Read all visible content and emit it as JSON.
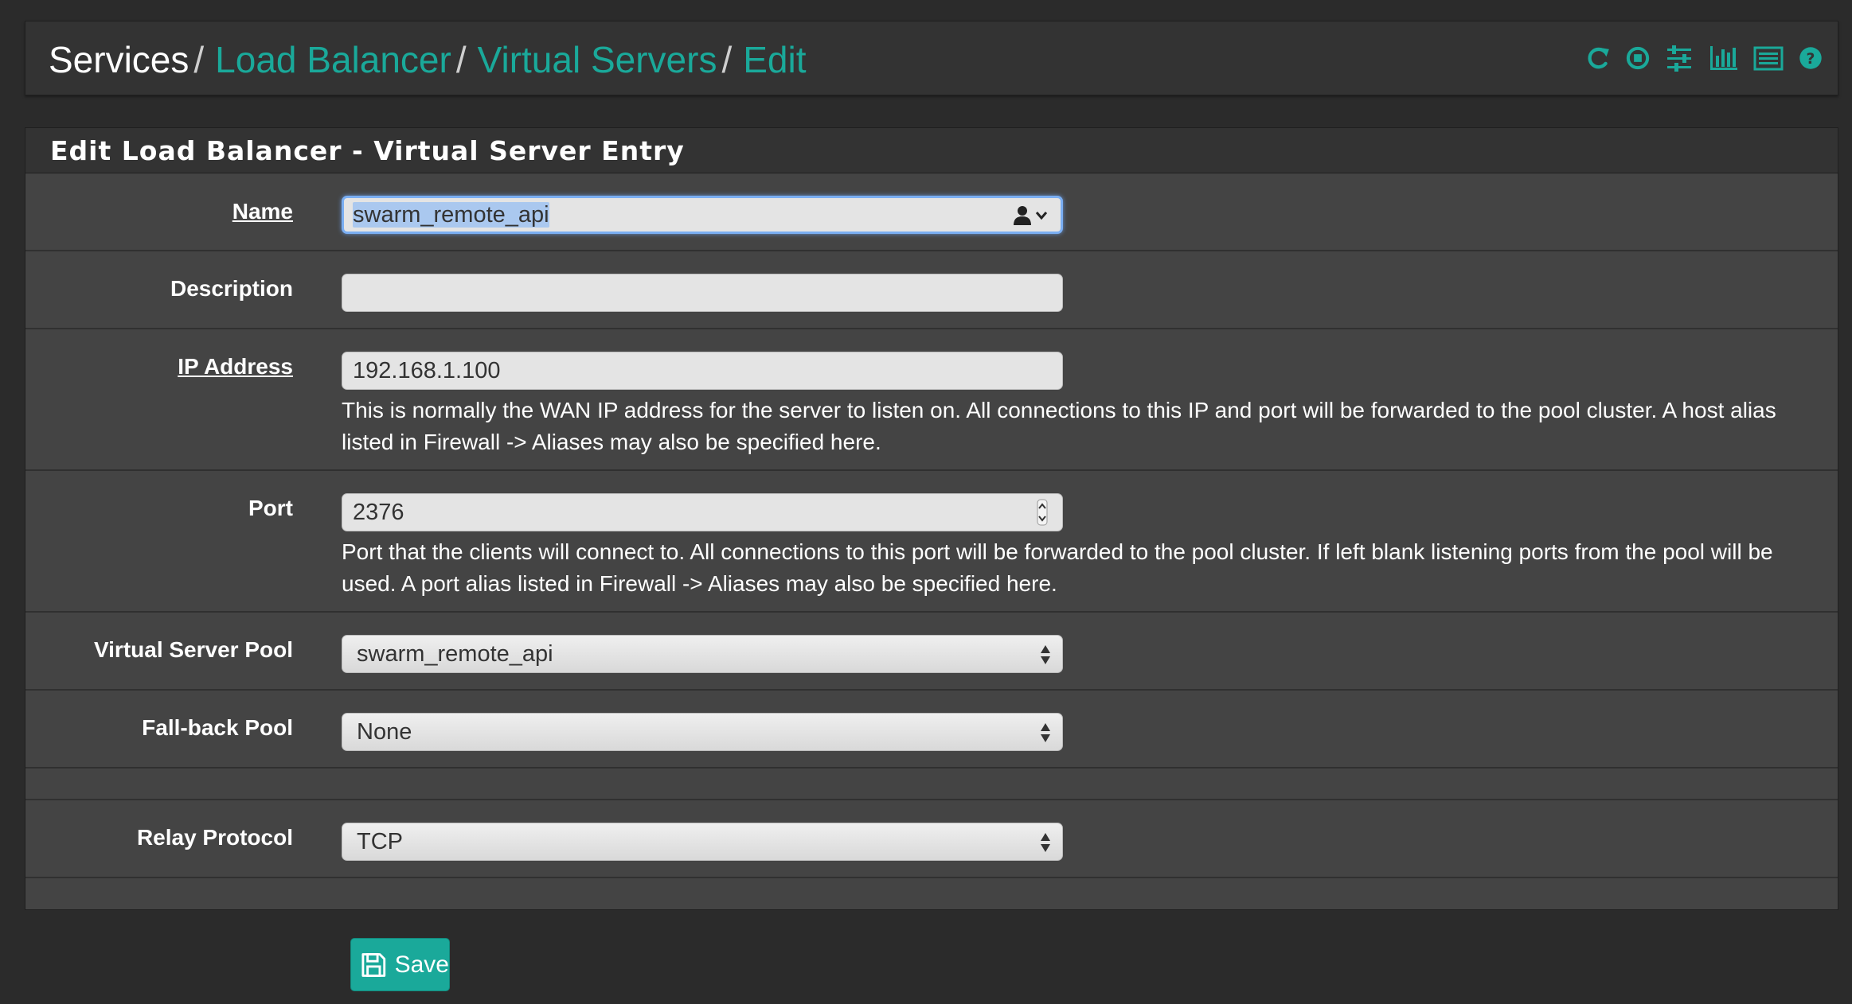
{
  "breadcrumb": {
    "root": "Services",
    "level1": "Load Balancer",
    "level2": "Virtual Servers",
    "current": "Edit",
    "separator": "/"
  },
  "toolbar": {
    "icons": [
      "reload-icon",
      "stop-icon",
      "sliders-icon",
      "bar-chart-icon",
      "log-list-icon",
      "help-icon"
    ]
  },
  "panel": {
    "title": "Edit Load Balancer - Virtual Server Entry"
  },
  "form": {
    "name": {
      "label": "Name",
      "value": "swarm_remote_api"
    },
    "description": {
      "label": "Description",
      "value": ""
    },
    "ip_address": {
      "label": "IP Address",
      "value": "192.168.1.100",
      "help": "This is normally the WAN IP address for the server to listen on. All connections to this IP and port will be forwarded to the pool cluster. A host alias listed in Firewall -> Aliases may also be specified here."
    },
    "port": {
      "label": "Port",
      "value": "2376",
      "help": "Port that the clients will connect to. All connections to this port will be forwarded to the pool cluster. If left blank listening ports from the pool will be used. A port alias listed in Firewall -> Aliases may also be specified here."
    },
    "virtual_server_pool": {
      "label": "Virtual Server Pool",
      "value": "swarm_remote_api"
    },
    "fallback_pool": {
      "label": "Fall-back Pool",
      "value": "None"
    },
    "relay_protocol": {
      "label": "Relay Protocol",
      "value": "TCP"
    }
  },
  "actions": {
    "save_label": "Save"
  },
  "colors": {
    "accent": "#1aa99a",
    "page_bg": "#2b2b2b",
    "panel_bg": "#444444",
    "heading_bg": "#333333"
  }
}
